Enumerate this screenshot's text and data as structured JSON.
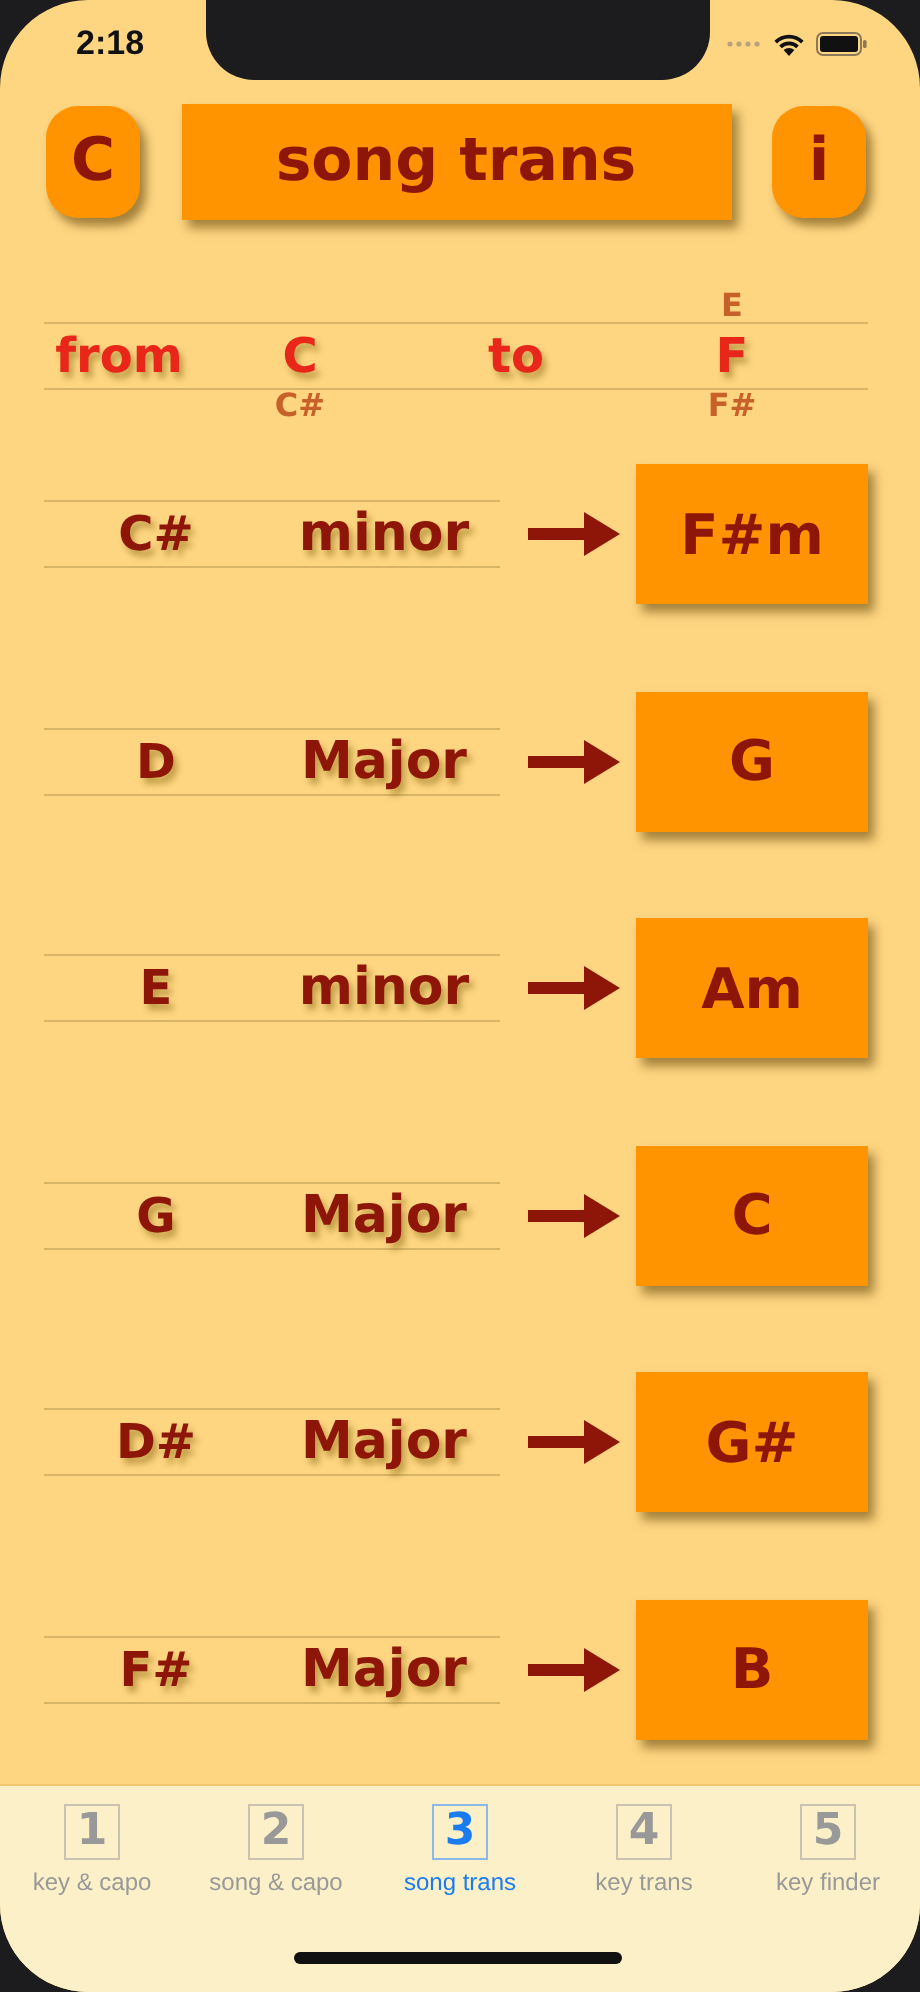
{
  "status_bar": {
    "time": "2:18"
  },
  "header": {
    "left_button": "C",
    "title": "song trans",
    "right_button": "i"
  },
  "key_picker": {
    "from": {
      "label": "from",
      "value": "C",
      "below": "C#"
    },
    "to": {
      "label": "to",
      "above": "E",
      "value": "F",
      "below": "F#"
    }
  },
  "chords": [
    {
      "root": "C#",
      "quality": "minor",
      "result": "F#m"
    },
    {
      "root": "D",
      "quality": "Major",
      "result": "G"
    },
    {
      "root": "E",
      "quality": "minor",
      "result": "Am"
    },
    {
      "root": "G",
      "quality": "Major",
      "result": "C"
    },
    {
      "root": "D#",
      "quality": "Major",
      "result": "G#"
    },
    {
      "root": "F#",
      "quality": "Major",
      "result": "B"
    }
  ],
  "tabs": [
    {
      "number": "1",
      "label": "key & capo",
      "selected": false
    },
    {
      "number": "2",
      "label": "song & capo",
      "selected": false
    },
    {
      "number": "3",
      "label": "song trans",
      "selected": true
    },
    {
      "number": "4",
      "label": "key trans",
      "selected": false
    },
    {
      "number": "5",
      "label": "key finder",
      "selected": false
    }
  ]
}
